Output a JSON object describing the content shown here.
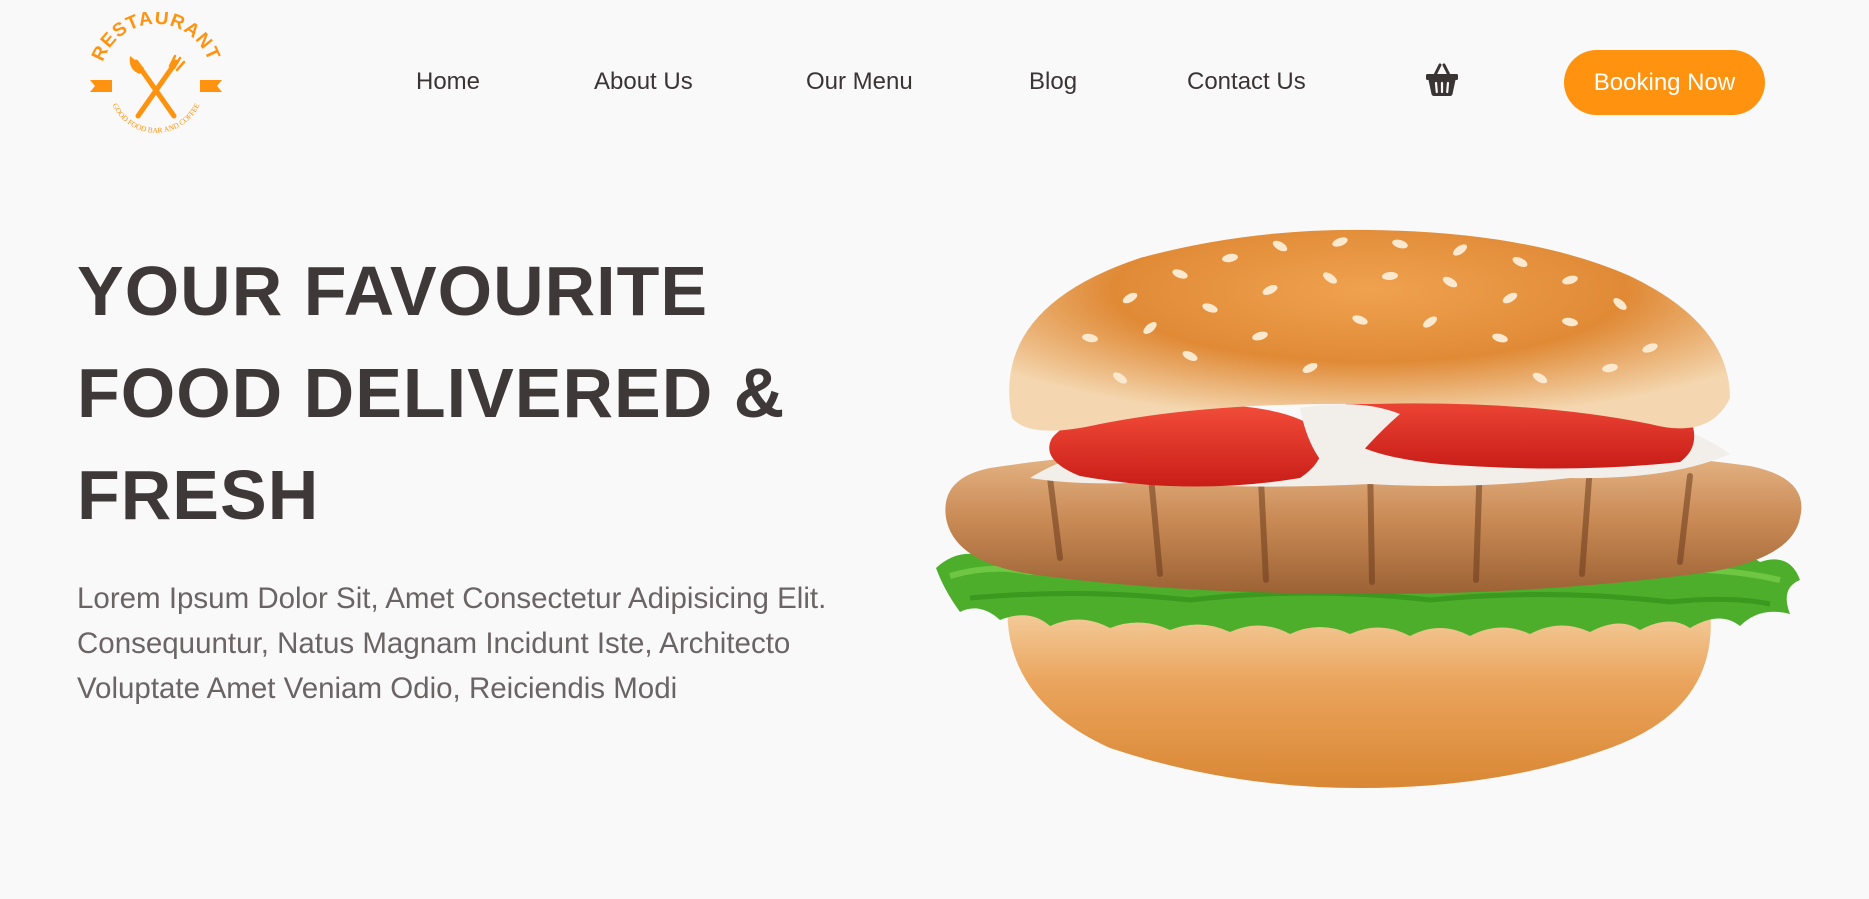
{
  "logo": {
    "arc_text": "RESTAURANT",
    "sub_text": "GOOD FOOD BAR AND COFFEE",
    "color": "#ff930f"
  },
  "nav": {
    "items": [
      {
        "label": "Home"
      },
      {
        "label": "About Us"
      },
      {
        "label": "Our Menu"
      },
      {
        "label": "Blog"
      },
      {
        "label": "Contact Us"
      }
    ],
    "cart_icon": "shopping-basket-icon",
    "booking_label": "Booking Now"
  },
  "hero": {
    "title_lines": [
      "YOUR FAVOURITE",
      "FOOD DELIVERED &",
      "FRESH"
    ],
    "description": "Lorem Ipsum Dolor Sit, Amet Consectetur Adipisicing Elit. Consequuntur, Natus Magnam Incidunt Iste, Architecto Voluptate Amet Veniam Odio, Reiciendis Modi"
  },
  "colors": {
    "accent": "#ff930f",
    "text_dark": "#3f3839",
    "text_muted": "#6b6465",
    "background": "#f9f9fa"
  }
}
